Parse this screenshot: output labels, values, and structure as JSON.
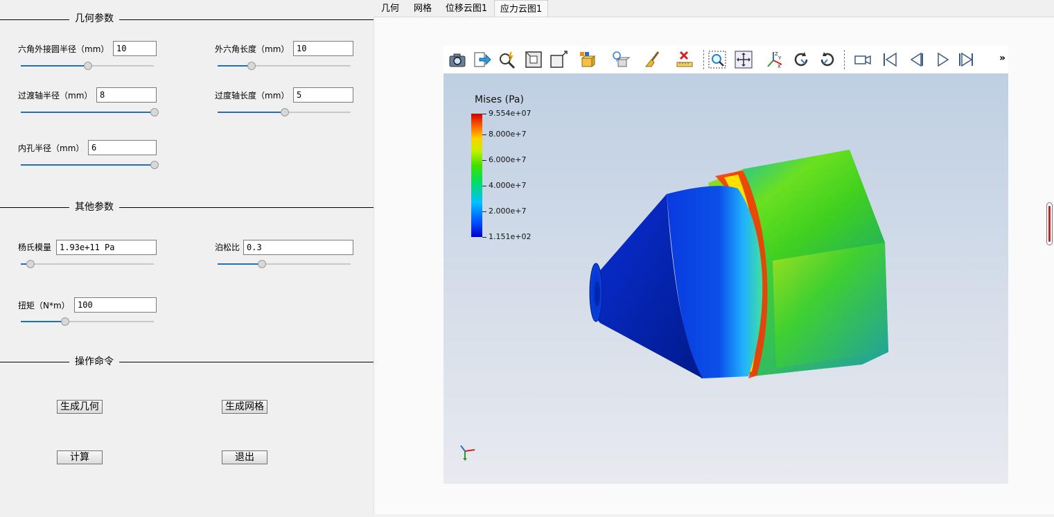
{
  "groups": {
    "geometry": "几何参数",
    "other": "其他参数",
    "commands": "操作命令"
  },
  "params": {
    "hex_radius": {
      "label": "六角外接圆半径（mm）",
      "value": "10",
      "slider_pos": 0.5
    },
    "hex_length": {
      "label": "外六角长度（mm）",
      "value": "10",
      "slider_pos": 0.25
    },
    "trans_radius": {
      "label": "过渡轴半径（mm）",
      "value": "8",
      "slider_pos": 1.0
    },
    "trans_length": {
      "label": "过度轴长度（mm）",
      "value": "5",
      "slider_pos": 0.5
    },
    "hole_radius": {
      "label": "内孔半径（mm）",
      "value": "6",
      "slider_pos": 1.0
    },
    "youngs": {
      "label": "杨氏模量",
      "value": "1.93e+11 Pa",
      "slider_pos": 0.07
    },
    "poisson": {
      "label": "泊松比",
      "value": "0.3",
      "slider_pos": 0.33
    },
    "torque": {
      "label": "扭矩（N*m）",
      "value": "100",
      "slider_pos": 0.33
    }
  },
  "buttons": {
    "gen_geometry": "生成几何",
    "gen_mesh": "生成网格",
    "compute": "计算",
    "exit": "退出"
  },
  "tabs": [
    "几何",
    "网格",
    "位移云图1",
    "应力云图1"
  ],
  "active_tab": "应力云图1",
  "toolbar_icons": [
    "camera-icon",
    "export-icon",
    "zoom-magic-icon",
    "fit-view-icon",
    "box-select-icon",
    "cube-color-icon",
    "light-icon",
    "brush-icon",
    "ruler-clear-icon",
    "zoom-box-icon",
    "pan-move-icon",
    "axes-icon",
    "rotate-cw-icon",
    "rotate-ccw-icon",
    "video-camera-icon",
    "first-frame-icon",
    "prev-frame-icon",
    "play-icon",
    "last-frame-icon"
  ],
  "toolbar_more": "»",
  "legend": {
    "title": "Mises (Pa)",
    "labels": [
      "9.554e+07",
      "8.000e+7",
      "6.000e+7",
      "4.000e+7",
      "2.000e+7",
      "1.151e+02"
    ]
  },
  "colors": {
    "slider_fill": "#1f6fb8",
    "viewport_top": "#bfcfe3",
    "viewport_bottom": "#e8eaef"
  }
}
